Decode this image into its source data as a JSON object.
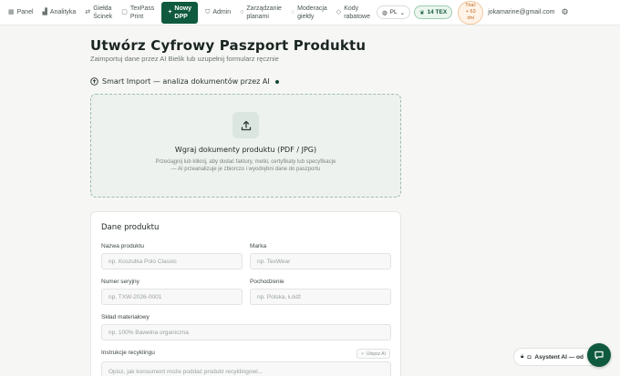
{
  "nav": {
    "items": [
      {
        "icon": "grid-icon",
        "label": "Panel"
      },
      {
        "icon": "bar-chart-icon",
        "label": "Analityka"
      },
      {
        "icon": "exchange-icon",
        "label_line1": "Giełda",
        "label_line2": "Ścinek"
      },
      {
        "icon": "document-icon",
        "label_line1": "TexPass",
        "label_line2": "Print"
      }
    ],
    "cta": {
      "icon": "plus-icon",
      "label_line1": "Nowy",
      "label_line2": "DPP"
    },
    "items_right": [
      {
        "icon": "shield-icon",
        "label": "Admin"
      },
      {
        "icon": "circle-icon",
        "label_line1": "Zarządzanie",
        "label_line2": "planami"
      },
      {
        "icon": "check-circle-icon",
        "label_line1": "Moderacja",
        "label_line2": "giełdy"
      },
      {
        "icon": "tag-icon",
        "label_line1": "Kody",
        "label_line2": "rabatowe"
      }
    ],
    "language": "PL",
    "tex_balance": "14 TEX",
    "trial": {
      "line1": "Trial:",
      "line2": "+ 63",
      "line3": "dni"
    },
    "email": "jokamarine@gmail.com"
  },
  "header": {
    "title": "Utwórz Cyfrowy Paszport Produktu",
    "subtitle": "Zaimportuj dane przez AI Bielik lub uzupełnij formularz ręcznie"
  },
  "smart_import": {
    "heading": "Smart Import — analiza dokumentów przez AI"
  },
  "upload": {
    "title": "Wgraj dokumenty produktu (PDF / JPG)",
    "description": "Przeciągnij lub kliknij, aby dodać faktury, metki, certyfikaty lub specyfikacje — AI przeanalizuje je zbiorczo i wyodrębni dane do paszportu"
  },
  "form": {
    "title": "Dane produktu",
    "fields": {
      "product_name": {
        "label": "Nazwa produktu",
        "placeholder": "np. Koszulka Polo Classic"
      },
      "brand": {
        "label": "Marka",
        "placeholder": "np. TexWear"
      },
      "serial": {
        "label": "Numer seryjny",
        "placeholder": "np. TXW-2026-0001"
      },
      "origin": {
        "label": "Pochodzenie",
        "placeholder": "np. Polska, Łódź"
      },
      "composition": {
        "label": "Skład materiałowy",
        "placeholder": "np. 100% Bawełna organiczna"
      },
      "recycling": {
        "label": "Instrukcje recyklingu",
        "placeholder": "Opisz, jak konsument może poddać produkt recyklingowi..."
      }
    },
    "ai_button": "Ulepsz AI"
  },
  "assistant": {
    "label": "Asystent AI — od"
  }
}
